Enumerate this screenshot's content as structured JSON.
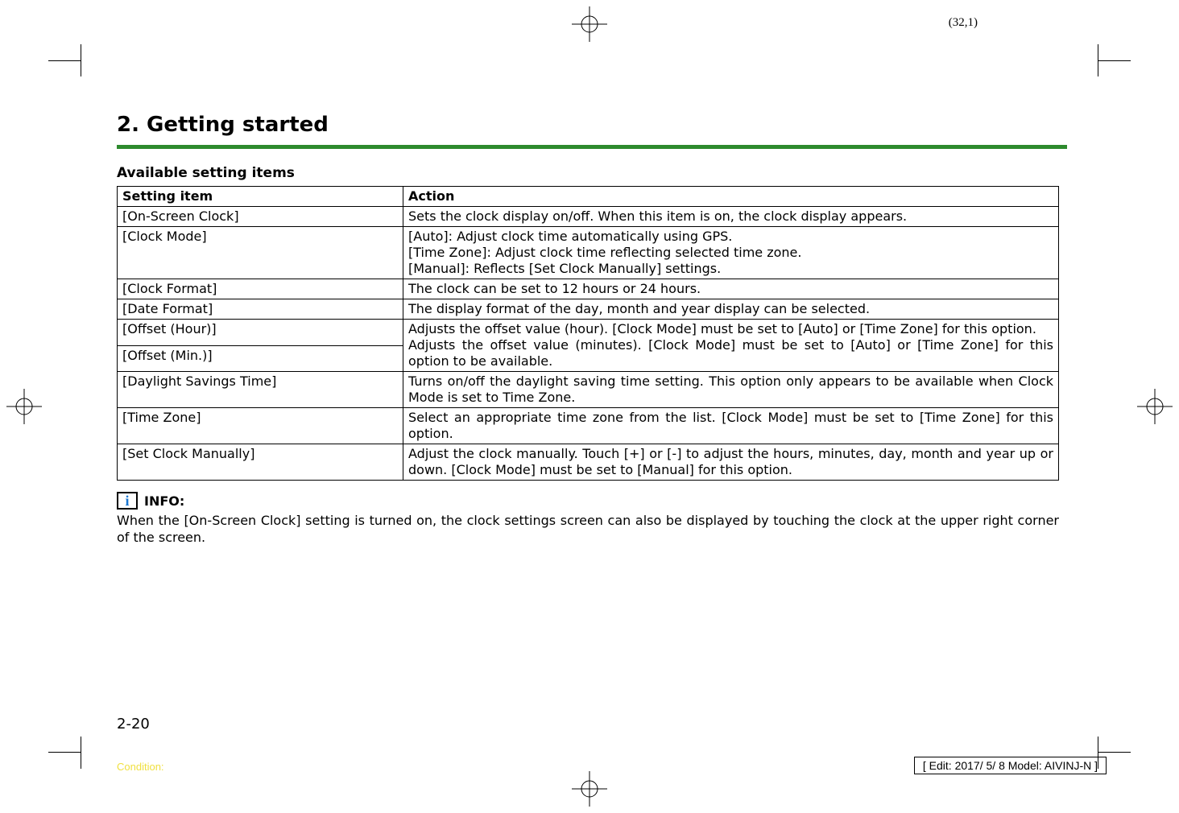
{
  "page_coord": "(32,1)",
  "section_title": "2. Getting started",
  "subheading": "Available setting items",
  "table": {
    "headers": [
      "Setting item",
      "Action"
    ],
    "rows": [
      {
        "item": "[On-Screen Clock]",
        "action": "Sets the clock display on/off. When this item is on, the clock display appears."
      },
      {
        "item": "[Clock Mode]",
        "action": "[Auto]: Adjust clock time automatically using GPS.\n[Time Zone]: Adjust clock time reflecting selected time zone.\n[Manual]: Reflects [Set Clock Manually] settings."
      },
      {
        "item": "[Clock Format]",
        "action": "The clock can be set to 12 hours or 24 hours."
      },
      {
        "item": "[Date Format]",
        "action": "The display format of the day, month and year display can be selected."
      },
      {
        "item_a": "[Offset (Hour)]",
        "item_b": "[Offset (Min.)]",
        "action": "Adjusts the offset value (hour). [Clock Mode] must be set to [Auto] or [Time Zone] for this option.\nAdjusts the offset value (minutes). [Clock Mode] must be set to [Auto] or [Time Zone] for this option to be available."
      },
      {
        "item": "[Daylight Savings Time]",
        "action": "Turns on/off the daylight saving time setting. This option only appears to be available when Clock Mode is set to Time Zone."
      },
      {
        "item": "[Time Zone]",
        "action": "Select an appropriate time zone from the list. [Clock Mode] must be set to [Time Zone] for this option."
      },
      {
        "item": "[Set Clock Manually]",
        "action": "Adjust the clock manually. Touch [+] or [-] to adjust the hours, minutes, day, month and year up or down. [Clock Mode] must be set to [Manual] for this option."
      }
    ]
  },
  "info": {
    "label": "INFO:",
    "text": "When the [On-Screen Clock] setting is turned on, the clock settings screen can also be displayed by touching the clock at the upper right corner of the screen."
  },
  "page_number": "2-20",
  "condition": "Condition:",
  "edit_box": "[ Edit: 2017/ 5/ 8   Model: AIVINJ-N ]"
}
